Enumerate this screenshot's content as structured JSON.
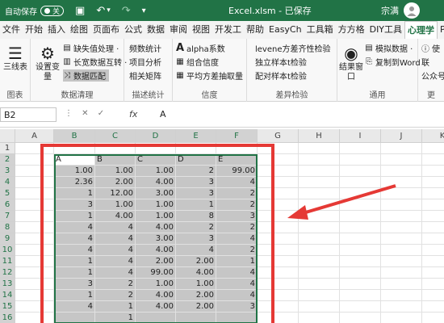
{
  "titlebar": {
    "autosave_label": "自动保存",
    "autosave_state": "关",
    "document_title": "Excel.xlsm - 已保存",
    "user_name": "宗满"
  },
  "tabs": [
    "文件",
    "开始",
    "插入",
    "绘图",
    "页面布",
    "公式",
    "数据",
    "审阅",
    "视图",
    "开发工",
    "帮助",
    "EasyCh",
    "工具箱",
    "方方格",
    "DIY工具",
    "心理学",
    "PDF"
  ],
  "active_tab_index": 15,
  "ribbon": {
    "group1": {
      "label": "图表",
      "button": "三线表"
    },
    "group2": {
      "label": "数据清理",
      "big_button": "设置变量",
      "items": [
        "缺失值处理 ·",
        "长宽数据互转 ·",
        "数据匹配"
      ]
    },
    "group3": {
      "label": "描述统计",
      "items": [
        "频数统计",
        "项目分析",
        "相关矩阵"
      ]
    },
    "group4": {
      "label": "信度",
      "items": [
        "alpha系数",
        "组合信度",
        "平均方差抽取量"
      ]
    },
    "group5": {
      "label": "差异检验",
      "items": [
        "levene方差齐性检验",
        "独立样本t检验",
        "配对样本t检验"
      ]
    },
    "group6": {
      "label": "通用",
      "big_button": "结果窗口",
      "items": [
        "模拟数据 ·",
        "复制到Word"
      ]
    },
    "group7": {
      "label": "更",
      "items": [
        "使",
        "联",
        "公众号"
      ]
    }
  },
  "formula_bar": {
    "name_box": "B2",
    "fx": "fx",
    "value": "A"
  },
  "grid": {
    "columns": [
      "A",
      "B",
      "C",
      "D",
      "E",
      "F",
      "G",
      "H",
      "I",
      "J",
      "K"
    ],
    "selected_columns": [
      "B",
      "C",
      "D",
      "E",
      "F"
    ],
    "rows": [
      "1",
      "2",
      "3",
      "4",
      "5",
      "6",
      "7",
      "8",
      "9",
      "10",
      "11",
      "12",
      "13",
      "14",
      "15",
      "16"
    ],
    "data": [
      [
        "A",
        "B",
        "C",
        "D",
        "E"
      ],
      [
        "1.00",
        "1.00",
        "1.00",
        "2",
        "99.00"
      ],
      [
        "2.36",
        "2.00",
        "4.00",
        "3",
        "4"
      ],
      [
        "1",
        "12.00",
        "3.00",
        "3",
        "2"
      ],
      [
        "3",
        "1.00",
        "1.00",
        "1",
        "2"
      ],
      [
        "1",
        "4.00",
        "1.00",
        "8",
        "3"
      ],
      [
        "4",
        "4",
        "4.00",
        "2",
        "2"
      ],
      [
        "4",
        "4",
        "3.00",
        "3",
        "4"
      ],
      [
        "4",
        "4",
        "4.00",
        "4",
        "2"
      ],
      [
        "1",
        "4",
        "2.00",
        "2.00",
        "1"
      ],
      [
        "1",
        "4",
        "99.00",
        "4.00",
        "4"
      ],
      [
        "3",
        "2",
        "1.00",
        "1.00",
        "4"
      ],
      [
        "1",
        "2",
        "4.00",
        "2.00",
        "4"
      ],
      [
        "4",
        "1",
        "4.00",
        "2.00",
        "3"
      ],
      [
        "",
        "1",
        "",
        "",
        ""
      ]
    ]
  },
  "colors": {
    "excel_green": "#217346",
    "selection_fill": "#c6c6c6",
    "annotation_red": "#e53935"
  }
}
